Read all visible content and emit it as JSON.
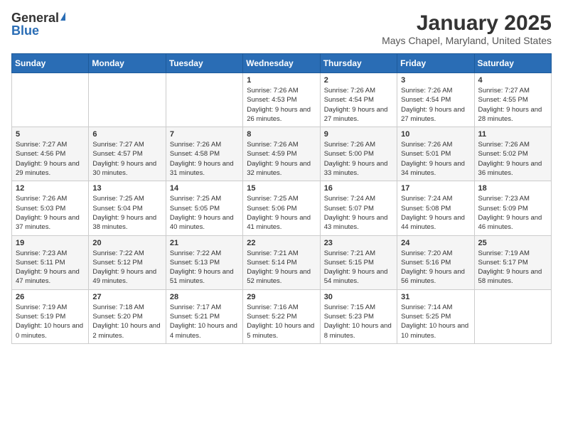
{
  "header": {
    "logo_general": "General",
    "logo_blue": "Blue",
    "month": "January 2025",
    "location": "Mays Chapel, Maryland, United States"
  },
  "weekdays": [
    "Sunday",
    "Monday",
    "Tuesday",
    "Wednesday",
    "Thursday",
    "Friday",
    "Saturday"
  ],
  "weeks": [
    [
      {
        "day": "",
        "info": ""
      },
      {
        "day": "",
        "info": ""
      },
      {
        "day": "",
        "info": ""
      },
      {
        "day": "1",
        "info": "Sunrise: 7:26 AM\nSunset: 4:53 PM\nDaylight: 9 hours and 26 minutes."
      },
      {
        "day": "2",
        "info": "Sunrise: 7:26 AM\nSunset: 4:54 PM\nDaylight: 9 hours and 27 minutes."
      },
      {
        "day": "3",
        "info": "Sunrise: 7:26 AM\nSunset: 4:54 PM\nDaylight: 9 hours and 27 minutes."
      },
      {
        "day": "4",
        "info": "Sunrise: 7:27 AM\nSunset: 4:55 PM\nDaylight: 9 hours and 28 minutes."
      }
    ],
    [
      {
        "day": "5",
        "info": "Sunrise: 7:27 AM\nSunset: 4:56 PM\nDaylight: 9 hours and 29 minutes."
      },
      {
        "day": "6",
        "info": "Sunrise: 7:27 AM\nSunset: 4:57 PM\nDaylight: 9 hours and 30 minutes."
      },
      {
        "day": "7",
        "info": "Sunrise: 7:26 AM\nSunset: 4:58 PM\nDaylight: 9 hours and 31 minutes."
      },
      {
        "day": "8",
        "info": "Sunrise: 7:26 AM\nSunset: 4:59 PM\nDaylight: 9 hours and 32 minutes."
      },
      {
        "day": "9",
        "info": "Sunrise: 7:26 AM\nSunset: 5:00 PM\nDaylight: 9 hours and 33 minutes."
      },
      {
        "day": "10",
        "info": "Sunrise: 7:26 AM\nSunset: 5:01 PM\nDaylight: 9 hours and 34 minutes."
      },
      {
        "day": "11",
        "info": "Sunrise: 7:26 AM\nSunset: 5:02 PM\nDaylight: 9 hours and 36 minutes."
      }
    ],
    [
      {
        "day": "12",
        "info": "Sunrise: 7:26 AM\nSunset: 5:03 PM\nDaylight: 9 hours and 37 minutes."
      },
      {
        "day": "13",
        "info": "Sunrise: 7:25 AM\nSunset: 5:04 PM\nDaylight: 9 hours and 38 minutes."
      },
      {
        "day": "14",
        "info": "Sunrise: 7:25 AM\nSunset: 5:05 PM\nDaylight: 9 hours and 40 minutes."
      },
      {
        "day": "15",
        "info": "Sunrise: 7:25 AM\nSunset: 5:06 PM\nDaylight: 9 hours and 41 minutes."
      },
      {
        "day": "16",
        "info": "Sunrise: 7:24 AM\nSunset: 5:07 PM\nDaylight: 9 hours and 43 minutes."
      },
      {
        "day": "17",
        "info": "Sunrise: 7:24 AM\nSunset: 5:08 PM\nDaylight: 9 hours and 44 minutes."
      },
      {
        "day": "18",
        "info": "Sunrise: 7:23 AM\nSunset: 5:09 PM\nDaylight: 9 hours and 46 minutes."
      }
    ],
    [
      {
        "day": "19",
        "info": "Sunrise: 7:23 AM\nSunset: 5:11 PM\nDaylight: 9 hours and 47 minutes."
      },
      {
        "day": "20",
        "info": "Sunrise: 7:22 AM\nSunset: 5:12 PM\nDaylight: 9 hours and 49 minutes."
      },
      {
        "day": "21",
        "info": "Sunrise: 7:22 AM\nSunset: 5:13 PM\nDaylight: 9 hours and 51 minutes."
      },
      {
        "day": "22",
        "info": "Sunrise: 7:21 AM\nSunset: 5:14 PM\nDaylight: 9 hours and 52 minutes."
      },
      {
        "day": "23",
        "info": "Sunrise: 7:21 AM\nSunset: 5:15 PM\nDaylight: 9 hours and 54 minutes."
      },
      {
        "day": "24",
        "info": "Sunrise: 7:20 AM\nSunset: 5:16 PM\nDaylight: 9 hours and 56 minutes."
      },
      {
        "day": "25",
        "info": "Sunrise: 7:19 AM\nSunset: 5:17 PM\nDaylight: 9 hours and 58 minutes."
      }
    ],
    [
      {
        "day": "26",
        "info": "Sunrise: 7:19 AM\nSunset: 5:19 PM\nDaylight: 10 hours and 0 minutes."
      },
      {
        "day": "27",
        "info": "Sunrise: 7:18 AM\nSunset: 5:20 PM\nDaylight: 10 hours and 2 minutes."
      },
      {
        "day": "28",
        "info": "Sunrise: 7:17 AM\nSunset: 5:21 PM\nDaylight: 10 hours and 4 minutes."
      },
      {
        "day": "29",
        "info": "Sunrise: 7:16 AM\nSunset: 5:22 PM\nDaylight: 10 hours and 5 minutes."
      },
      {
        "day": "30",
        "info": "Sunrise: 7:15 AM\nSunset: 5:23 PM\nDaylight: 10 hours and 8 minutes."
      },
      {
        "day": "31",
        "info": "Sunrise: 7:14 AM\nSunset: 5:25 PM\nDaylight: 10 hours and 10 minutes."
      },
      {
        "day": "",
        "info": ""
      }
    ]
  ]
}
